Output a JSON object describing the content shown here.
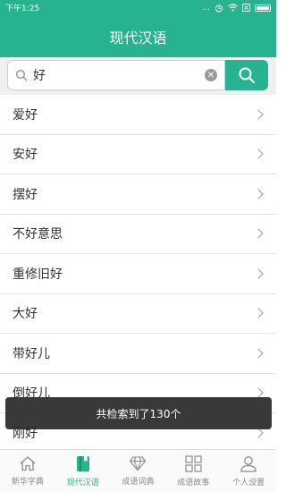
{
  "status": {
    "time": "下午1:25",
    "dots": "..."
  },
  "header": {
    "title": "现代汉语"
  },
  "search": {
    "value": "好",
    "placeholder": ""
  },
  "results": [
    {
      "label": "爱好"
    },
    {
      "label": "安好"
    },
    {
      "label": "摆好"
    },
    {
      "label": "不好意思"
    },
    {
      "label": "重修旧好"
    },
    {
      "label": "大好"
    },
    {
      "label": "带好儿"
    },
    {
      "label": "倒好儿"
    },
    {
      "label": "刚好"
    }
  ],
  "toast": {
    "text": "共检索到了130个"
  },
  "tabs": [
    {
      "label": "新华字典",
      "icon": "house-icon",
      "active": false
    },
    {
      "label": "现代汉语",
      "icon": "book-icon",
      "active": true
    },
    {
      "label": "成语词典",
      "icon": "diamond-icon",
      "active": false
    },
    {
      "label": "成语故事",
      "icon": "grid-icon",
      "active": false
    },
    {
      "label": "个人设置",
      "icon": "person-icon",
      "active": false
    }
  ],
  "colors": {
    "accent": "#27b38f",
    "toast_bg": "#282828"
  }
}
